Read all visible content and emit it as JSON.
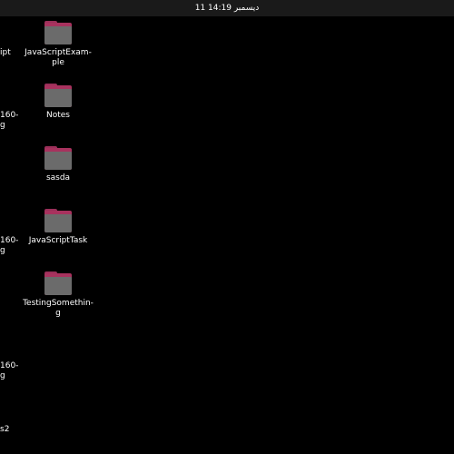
{
  "topbar": {
    "clock": "11 ديسمبر 14:19"
  },
  "desktop": {
    "icons": [
      {
        "label": "JavaScriptExam-\nple",
        "icon": "folder-icon"
      },
      {
        "label": "Notes",
        "icon": "folder-icon"
      },
      {
        "label": "sasda",
        "icon": "folder-icon"
      },
      {
        "label": "JavaScriptTask",
        "icon": "folder-icon"
      },
      {
        "label": "TestingSomethin-\ng",
        "icon": "folder-icon"
      }
    ],
    "edge_labels": [
      "ipt",
      "160-\ng",
      "160-\ng",
      "160-\ng",
      "s2"
    ]
  },
  "colors": {
    "background": "#000000",
    "topbar": "#1a1a1a",
    "folder_tab": "#a8325e",
    "folder_body": "#6b6b6b"
  }
}
